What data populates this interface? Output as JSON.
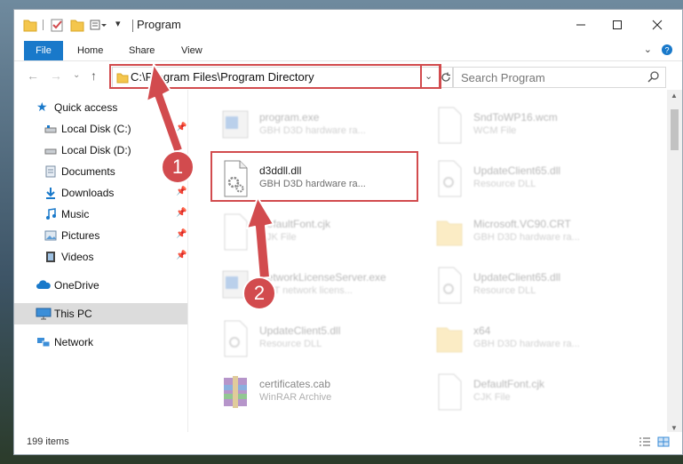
{
  "window": {
    "title": "Program"
  },
  "ribbon": {
    "tabs": [
      "File",
      "Home",
      "Share",
      "View"
    ]
  },
  "address": {
    "path": "C:\\Program Files\\Program Directory"
  },
  "search": {
    "placeholder": "Search Program"
  },
  "sidebar": {
    "quick_access": "Quick access",
    "items": [
      {
        "label": "Local Disk (C:)",
        "icon": "drive-icon",
        "pinned": true
      },
      {
        "label": "Local Disk (D:)",
        "icon": "drive-icon",
        "pinned": false
      },
      {
        "label": "Documents",
        "icon": "documents-icon",
        "pinned": true
      },
      {
        "label": "Downloads",
        "icon": "download-icon",
        "pinned": true
      },
      {
        "label": "Music",
        "icon": "music-icon",
        "pinned": true
      },
      {
        "label": "Pictures",
        "icon": "pictures-icon",
        "pinned": true
      },
      {
        "label": "Videos",
        "icon": "videos-icon",
        "pinned": true
      }
    ],
    "onedrive": "OneDrive",
    "this_pc": "This PC",
    "network": "Network"
  },
  "files": [
    {
      "name": "program.exe",
      "desc": "GBH D3D hardware ra...",
      "icon": "exe-icon",
      "highlighted": false
    },
    {
      "name": "SndToWP16.wcm",
      "desc": "WCM File",
      "icon": "file-icon",
      "highlighted": false
    },
    {
      "name": "d3ddll.dll",
      "desc": "GBH D3D hardware ra...",
      "icon": "dll-icon",
      "highlighted": true
    },
    {
      "name": "UpdateClient65.dll",
      "desc": "Resource DLL",
      "icon": "dll-icon",
      "highlighted": false
    },
    {
      "name": "DefaultFont.cjk",
      "desc": "CJK File",
      "icon": "file-icon",
      "highlighted": false
    },
    {
      "name": "Microsoft.VC90.CRT",
      "desc": "GBH D3D hardware ra...",
      "icon": "folder-icon",
      "highlighted": false
    },
    {
      "name": "NetworkLicenseServer.exe",
      "desc": "GNT network licens...",
      "icon": "exe-icon",
      "highlighted": false
    },
    {
      "name": "UpdateClient65.dll",
      "desc": "Resource DLL",
      "icon": "dll-icon",
      "highlighted": false
    },
    {
      "name": "UpdateClient5.dll",
      "desc": "Resource DLL",
      "icon": "dll-icon",
      "highlighted": false
    },
    {
      "name": "x64",
      "desc": "GBH D3D hardware ra...",
      "icon": "folder-icon",
      "highlighted": false
    },
    {
      "name": "certificates.cab",
      "desc": "WinRAR Archive",
      "icon": "archive-icon",
      "highlighted": false
    },
    {
      "name": "DefaultFont.cjk",
      "desc": "CJK File",
      "icon": "file-icon",
      "highlighted": false
    }
  ],
  "status": {
    "count": "199 items"
  },
  "annotations": {
    "step1": "1",
    "step2": "2"
  },
  "colors": {
    "accent": "#1979ca",
    "annotation": "#d24b4e"
  }
}
